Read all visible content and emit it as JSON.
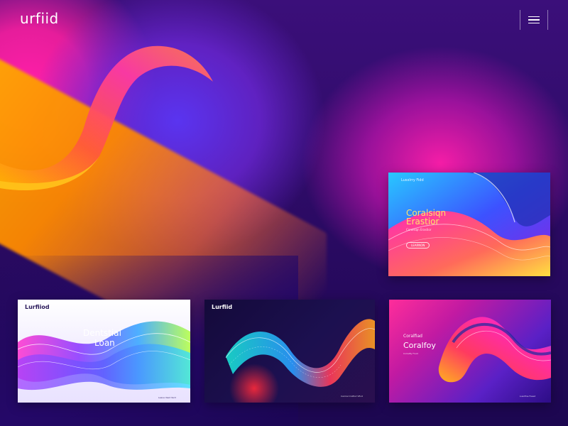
{
  "brand": {
    "logo_text": "urfiid"
  },
  "menu": {
    "icon": "hamburger-menu-icon"
  },
  "colors": {
    "background_dark": "#2a0a62",
    "magenta": "#ff1fa8",
    "violet": "#5a34f0",
    "orange": "#ff8a00",
    "yellow": "#ffb000"
  },
  "gallery": {
    "cards": [
      {
        "brand": "Lusxlrry Fidd",
        "headline_1": "Coralsiqn",
        "headline_2": "Erastior",
        "subtext": "Coralsiqn Erastior",
        "button": "LEARNON"
      },
      {
        "brand": "Lurfiiod",
        "headline_1": "Dentstial",
        "headline_2": "Loan",
        "footer": "Leave Vesd Verd"
      },
      {
        "brand": "Lurfiid",
        "footer": "Carmal Cluftod Vfiod"
      },
      {
        "brand": "Coralfiad",
        "headline_1": "Coralfoy",
        "subtext": "Colraifiy Fluot",
        "footer": "Lusxfine Fused"
      }
    ]
  }
}
